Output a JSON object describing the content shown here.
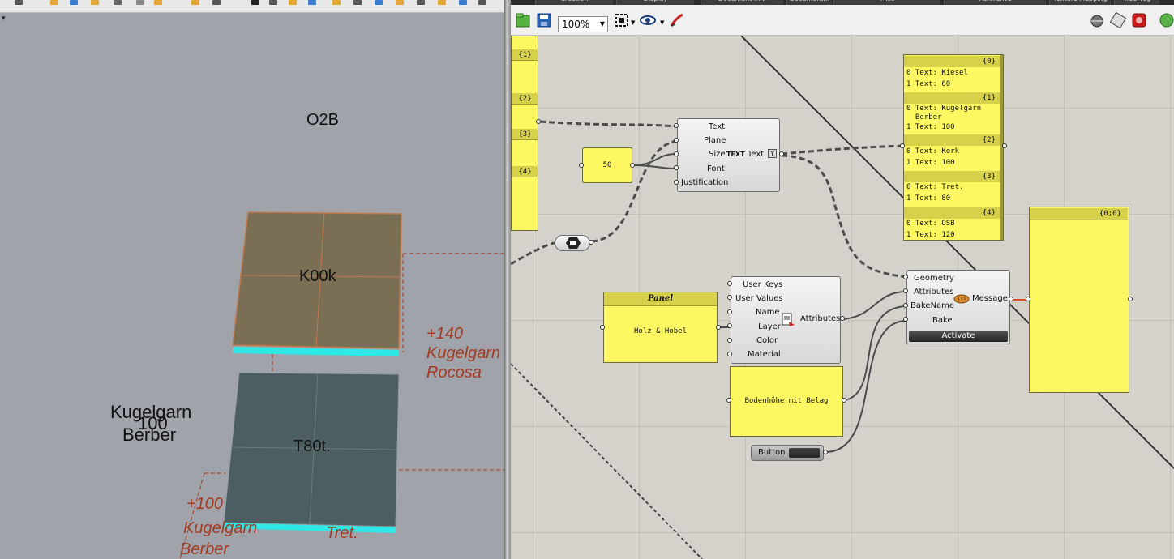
{
  "viewport": {
    "labels": {
      "top_overlay": "O2B",
      "tile1_overlay": "K00k",
      "tile2_overlay": "T80t.",
      "left_kugelgarn": "Kugelgarn",
      "left_100": "100",
      "left_berber": "Berber",
      "red_140": "+140",
      "red_kugelgarn": "Kugelgarn",
      "red_rocosa": "Rocosa",
      "red_100": "+100",
      "red_kugelgarn2": "Kugelgarn",
      "red_berber": "Berber",
      "red_tret": "Tret."
    }
  },
  "grasshopper": {
    "menu_tabs": [
      "Creation",
      "Display",
      "Document Info",
      "Document...",
      "Misc",
      "Reference",
      "Texture Mapping",
      "TreeFrog"
    ],
    "toolbar": {
      "zoom": "100%"
    },
    "left_panel": {
      "branches": [
        "{1}",
        "{2}",
        "{3}",
        "{4}"
      ]
    },
    "number_slider": {
      "value": "50"
    },
    "text_tag": {
      "inputs": [
        "Text",
        "Plane",
        "Size",
        "Font",
        "Justification"
      ],
      "center": "TEXT",
      "output": "Text"
    },
    "panel_holz": {
      "title": "Panel",
      "value": "Holz & Hobel"
    },
    "attributes_comp": {
      "inputs": [
        "User Keys",
        "User Values",
        "Name",
        "Layer",
        "Color",
        "Material"
      ],
      "output": "Attributes"
    },
    "panel_boden": {
      "value": "Bodenhöhe mit Belag"
    },
    "button": {
      "label": "Button"
    },
    "bake_comp": {
      "inputs": [
        "Geometry",
        "Attributes",
        "BakeName",
        "Bake"
      ],
      "output": "Message",
      "activate": "Activate"
    },
    "text_panel": {
      "branches": [
        {
          "header": "{0}",
          "rows": [
            "0 Text: Kiesel",
            "1 Text: 60"
          ]
        },
        {
          "header": "{1}",
          "rows": [
            "0 Text: Kugelgarn",
            "Berber",
            "1 Text: 100"
          ]
        },
        {
          "header": "{2}",
          "rows": [
            "0 Text: Kork",
            "1 Text: 100"
          ]
        },
        {
          "header": "{3}",
          "rows": [
            "0 Text: Tret.",
            "1 Text: 80"
          ]
        },
        {
          "header": "{4}",
          "rows": [
            "0 Text: OSB",
            "1 Text: 120"
          ]
        }
      ]
    },
    "message_panel": {
      "header": "{0;0}"
    },
    "colors": {
      "panel_yellow": "#fdf861",
      "panel_header": "#d6d04b",
      "canvas": "#d5d2cb"
    }
  }
}
